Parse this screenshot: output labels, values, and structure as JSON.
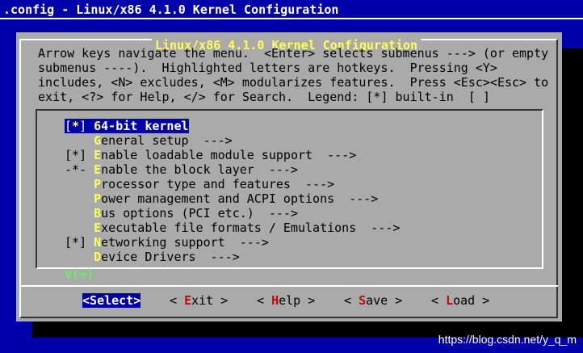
{
  "window": {
    "title": ".config - Linux/x86 4.1.0 Kernel Configuration"
  },
  "dialog": {
    "title": "Linux/x86 4.1.0 Kernel Configuration",
    "help_lines": [
      "Arrow keys navigate the menu.  <Enter> selects submenus ---> (or empty",
      "submenus ----).  Highlighted letters are hotkeys.  Pressing <Y>",
      "includes, <N> excludes, <M> modularizes features.  Press <Esc><Esc> to",
      "exit, <?> for Help, </> for Search.  Legend: [*] built-in  [ ]"
    ]
  },
  "menu": {
    "items": [
      {
        "prefix": "[",
        "mark": "*",
        "suffix": "] ",
        "hotkey": "6",
        "rest": "4-bit kernel",
        "selected": true
      },
      {
        "prefix": "    ",
        "mark": "",
        "suffix": "",
        "hotkey": "G",
        "rest": "eneral setup  --->",
        "selected": false
      },
      {
        "prefix": "[",
        "mark": "*",
        "suffix": "] ",
        "hotkey": "E",
        "rest": "nable loadable module support  --->",
        "selected": false
      },
      {
        "prefix": "-",
        "mark": "*",
        "suffix": "- ",
        "hotkey": "E",
        "rest": "nable the block layer  --->",
        "selected": false
      },
      {
        "prefix": "    ",
        "mark": "",
        "suffix": "",
        "hotkey": "P",
        "rest": "rocessor type and features  --->",
        "selected": false
      },
      {
        "prefix": "    ",
        "mark": "",
        "suffix": "",
        "hotkey": "P",
        "rest": "ower management and ACPI options  --->",
        "selected": false
      },
      {
        "prefix": "    ",
        "mark": "",
        "suffix": "",
        "hotkey": "B",
        "rest": "us options (PCI etc.)  --->",
        "selected": false
      },
      {
        "prefix": "    ",
        "mark": "",
        "suffix": "",
        "hotkey": "E",
        "rest": "xecutable file formats / Emulations  --->",
        "selected": false
      },
      {
        "prefix": "[",
        "mark": "*",
        "suffix": "] ",
        "hotkey": "N",
        "rest": "etworking support  --->",
        "selected": false
      },
      {
        "prefix": "    ",
        "mark": "",
        "suffix": "",
        "hotkey": "D",
        "rest": "evice Drivers  --->",
        "selected": false
      }
    ],
    "more_indicator": "v(+)"
  },
  "buttons": {
    "select": {
      "open": "<",
      "hotkey": "S",
      "rest": "elect",
      "close": ">"
    },
    "exit": {
      "open": "< ",
      "hotkey": "E",
      "rest": "xit",
      "close": " >"
    },
    "help": {
      "open": "< ",
      "hotkey": "H",
      "rest": "elp",
      "close": " >"
    },
    "save": {
      "open": "< ",
      "hotkey": "S",
      "rest": "ave",
      "close": " >"
    },
    "load": {
      "open": "< ",
      "hotkey": "L",
      "rest": "oad",
      "close": " >"
    }
  },
  "watermark": "https://blog.csdn.net/y_q_m",
  "colors": {
    "background": "#0000aa",
    "dialog": "#aaaaaa",
    "title_text": "#ffff55",
    "hotkey_menu": "#ffff55",
    "hotkey_button": "#cc0000",
    "selection": "#0000aa",
    "more_indicator": "#55ff55"
  }
}
